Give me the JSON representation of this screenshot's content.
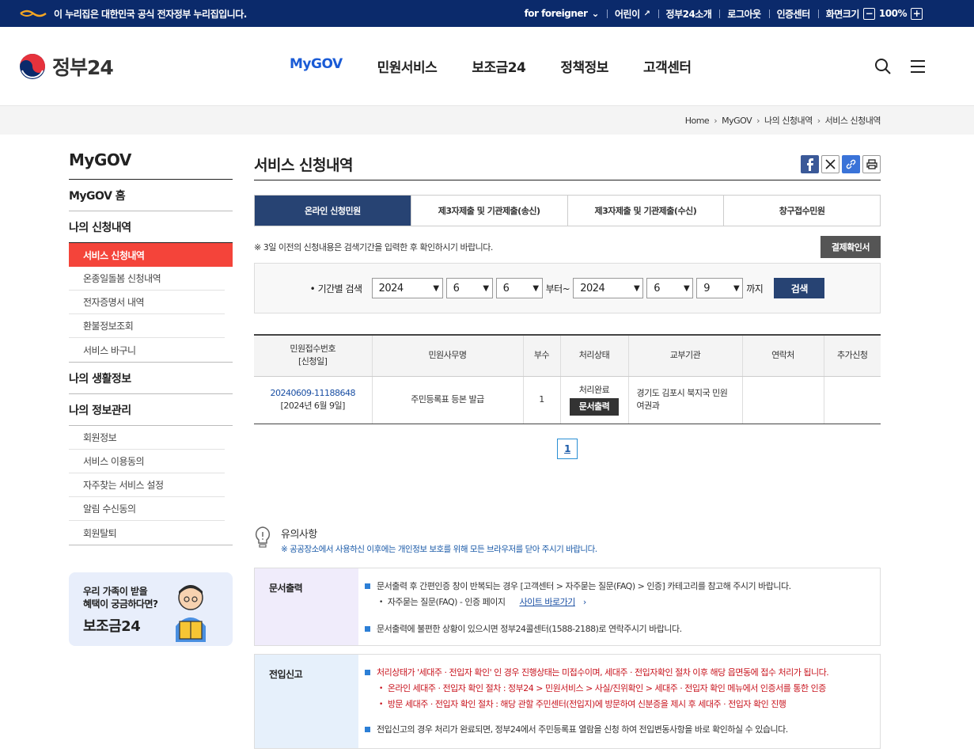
{
  "topbar": {
    "notice": "이 누리집은 대한민국 공식 전자정부 누리집입니다.",
    "links": [
      "for foreigner",
      "어린이",
      "정부24소개",
      "로그아웃",
      "인증센터"
    ],
    "zoom_label": "화면크기",
    "zoom_minus": "−",
    "zoom_value": "100%",
    "zoom_plus": "+"
  },
  "header": {
    "logo_text": "정부24",
    "gnb": [
      "MyGOV",
      "민원서비스",
      "보조금24",
      "정책정보",
      "고객센터"
    ]
  },
  "breadcrumb": [
    "Home",
    "MyGOV",
    "나의 신청내역",
    "서비스 신청내역"
  ],
  "lnb": {
    "title": "MyGOV",
    "home": "MyGOV 홈",
    "group1": "나의 신청내역",
    "group1_items": [
      "서비스 신청내역",
      "온종일돌봄 신청내역",
      "전자증명서 내역",
      "환불정보조회",
      "서비스 바구니"
    ],
    "group2": "나의 생활정보",
    "group3": "나의 정보관리",
    "group3_items": [
      "회원정보",
      "서비스 이용동의",
      "자주찾는 서비스 설정",
      "알림 수신동의",
      "회원탈퇴"
    ],
    "banner_line1": "우리 가족이 받을",
    "banner_line2": "혜택이 궁금하다면?",
    "banner_title": "보조금24"
  },
  "main": {
    "title": "서비스 신청내역",
    "tabs": [
      "온라인 신청민원",
      "제3자제출 및 기관제출(송신)",
      "제3자제출 및 기관제출(수신)",
      "창구접수민원"
    ],
    "notice": "※ 3일 이전의 신청내용은 검색기간을 입력한 후 확인하시기 바랍니다.",
    "payment_btn": "결제확인서",
    "search": {
      "label": "• 기간별 검색",
      "from_year": "2024",
      "from_month": "6",
      "from_day": "6",
      "from_suffix": "부터~",
      "to_year": "2024",
      "to_month": "6",
      "to_day": "9",
      "to_suffix": "까지",
      "button": "검색"
    },
    "table": {
      "headers": [
        "민원접수번호",
        "[신청일]",
        "민원사무명",
        "부수",
        "처리상태",
        "교부기관",
        "연락처",
        "추가신청"
      ],
      "rows": [
        {
          "receipt_no": "20240609-11188648",
          "date": "[2024년 6월 9일]",
          "name": "주민등록표 등본 발급",
          "copies": "1",
          "status": "처리완료",
          "print_btn": "문서출력",
          "agency": "경기도 김포시 북지국 민원여권과",
          "contact": "",
          "extra": ""
        }
      ]
    },
    "page": "1"
  },
  "caution": {
    "title": "유의사항",
    "sub": "※ 공공장소에서 사용하신 이후에는 개인정보 보호를 위해 모든 브라우저를 닫아 주시기 바랍니다."
  },
  "info1": {
    "head": "문서출력",
    "b1": "문서출력 후 간편인증 창이 반복되는 경우 [고객센터 > 자주묻는 질문(FAQ) > 인증] 카테고리를 참고해 주시기 바랍니다.",
    "sub1": "자주묻는 질문(FAQ) - 인증 페이지",
    "sub1_link": "사이트 바로가기",
    "b2": "문서출력에 불편한 상황이 있으시면 정부24콜센터(1588-2188)로 연락주시기 바랍니다."
  },
  "info2": {
    "head": "전입신고",
    "b1": "처리상태가 '세대주 · 전입자 확인' 인 경우 진행상태는 미접수이며, 세대주 · 전입자확인 절차 이후 해당 읍면동에 접수 처리가 됩니다.",
    "sub1": "온라인 세대주 · 전입자 확인 절차 : 정부24 > 민원서비스 > 사실/진위확인 > 세대주 · 전입자 확인 메뉴에서 인증서를 통한 인증",
    "sub2": "방문 세대주 · 전입자 확인 절차 : 해당 관할 주민센터(전입지)에 방문하여 신분증을 제시 후 세대주 · 전입자 확인 진행",
    "b2": "전입신고의 경우 처리가 완료되면, 정부24에서 주민등록표 열람을 신청 하여 전입변동사항을 바로 확인하실 수 있습니다."
  }
}
